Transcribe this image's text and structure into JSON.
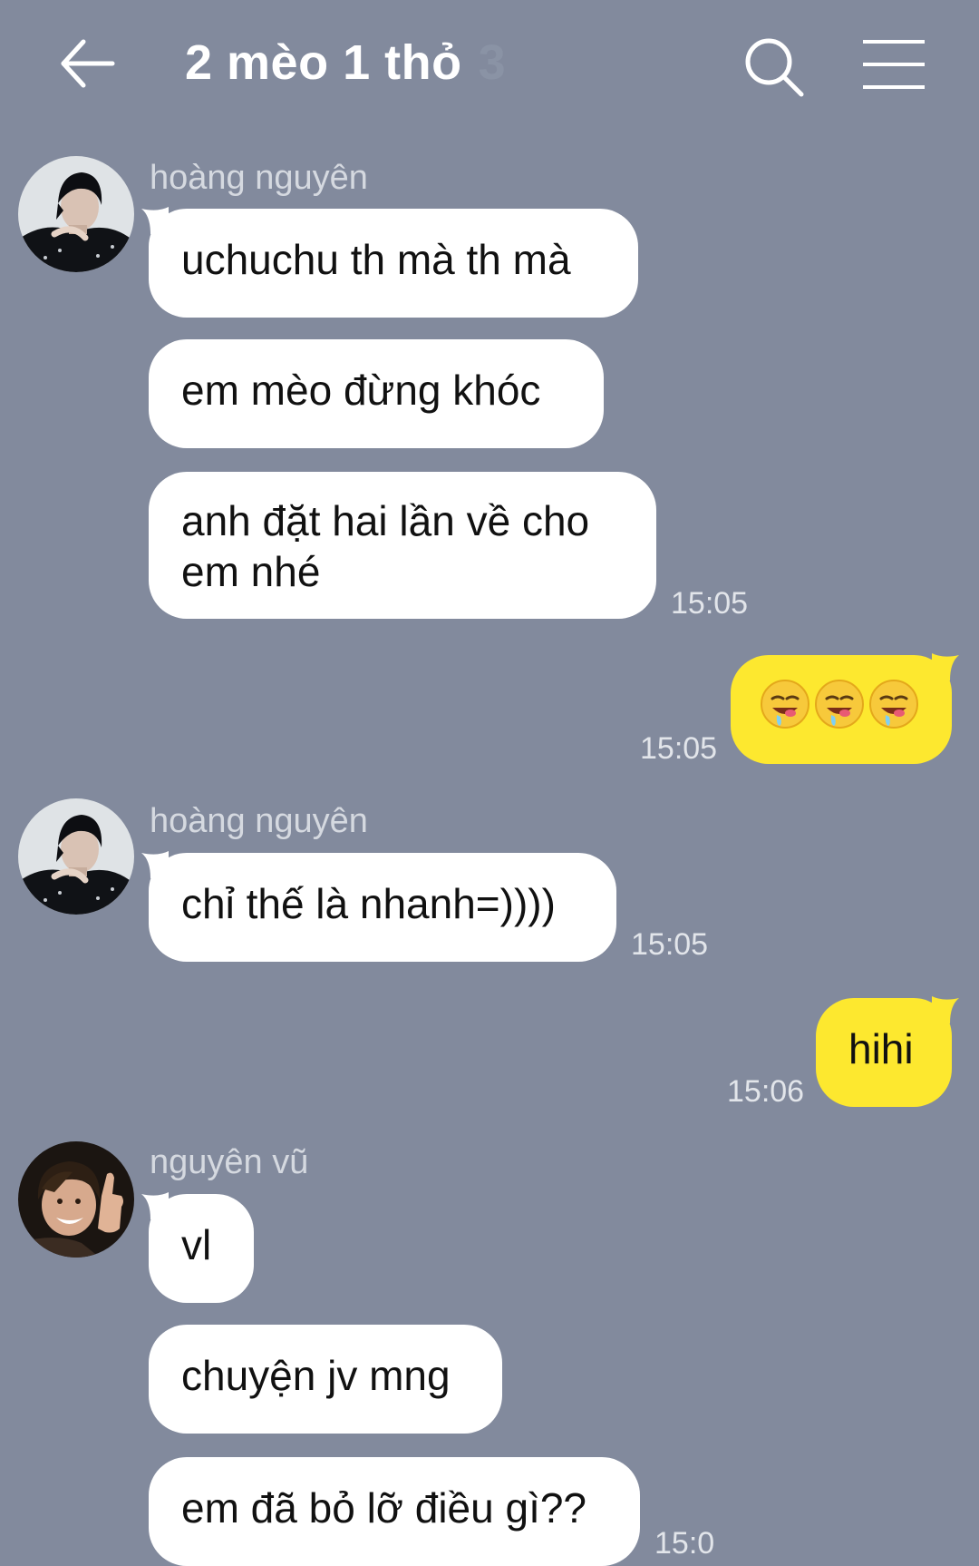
{
  "header": {
    "title": "2 mèo 1 thỏ",
    "member_count": "3",
    "icons": {
      "back": "arrow-left-icon",
      "search": "search-icon",
      "menu": "hamburger-menu-icon"
    }
  },
  "colors": {
    "background": "#828a9d",
    "incoming_bubble": "#ffffff",
    "outgoing_bubble": "#fde82f",
    "timestamp": "#e2e5ea",
    "sender_name": "#d5d9e0"
  },
  "messages": [
    {
      "sender": "hoàng nguyên",
      "direction": "incoming",
      "bubbles": [
        "uchuchu th mà th mà",
        "em mèo đừng khóc",
        "anh đặt hai lần về cho em nhé"
      ],
      "time": "15:05"
    },
    {
      "sender": "me",
      "direction": "outgoing",
      "bubbles": [
        "😋😋😋"
      ],
      "time": "15:05"
    },
    {
      "sender": "hoàng nguyên",
      "direction": "incoming",
      "bubbles": [
        "chỉ thế là nhanh=))))"
      ],
      "time": "15:05"
    },
    {
      "sender": "me",
      "direction": "outgoing",
      "bubbles": [
        "hihi"
      ],
      "time": "15:06"
    },
    {
      "sender": "nguyên vũ",
      "direction": "incoming",
      "bubbles": [
        "vl",
        "chuyện jv mng",
        "em đã bỏ lỡ điều gì??"
      ],
      "time": "15:0"
    }
  ]
}
